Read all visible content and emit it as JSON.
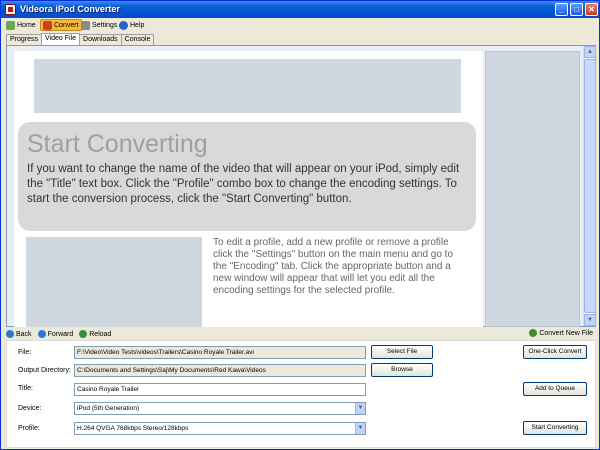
{
  "window": {
    "title": "Videora iPod Converter"
  },
  "menu": [
    {
      "label": "Home",
      "icon": "home-icon"
    },
    {
      "label": "Convert",
      "icon": "convert-icon"
    },
    {
      "label": "Settings",
      "icon": "settings-icon"
    },
    {
      "label": "Help",
      "icon": "help-icon"
    }
  ],
  "tabs": [
    "Progress",
    "Video File",
    "Downloads",
    "Console"
  ],
  "content": {
    "heading": "Start Converting",
    "intro": "If you want to change the name of the video that will appear on your iPod, simply edit the \"Title\" text box. Click the \"Profile\" combo box to change the encoding settings. To start the conversion process, click the \"Start Converting\" button.",
    "side_text": "To edit a profile, add a new profile or remove a profile click the \"Settings\" button on the main menu and go to the \"Encoding\" tab. Click the appropriate button and a new window will appear that will let you edit all the encoding settings for the selected profile."
  },
  "nav": {
    "back": "Back",
    "forward": "Forward",
    "reload": "Reload",
    "convert_new": "Convert New File"
  },
  "form": {
    "file_label": "File:",
    "file_value": "F:\\Video\\Video Tests\\videos\\Trailers\\Casino Royale Trailer.avi",
    "output_label": "Output Directory:",
    "output_value": "C:\\Documents and Settings\\Saj\\My Documents\\Red Kawa\\Videos",
    "title_label": "Title:",
    "title_value": "Casino Royale Trailer",
    "device_label": "Device:",
    "device_value": "iPod (5th Generation)",
    "profile_label": "Profile:",
    "profile_value": "H.264 QVGA 768kbps Stereo/128kbps",
    "select_file": "Select File",
    "browse": "Browse",
    "one_click": "One-Click Convert",
    "add_queue": "Add to Queue",
    "start_converting": "Start Converting"
  }
}
